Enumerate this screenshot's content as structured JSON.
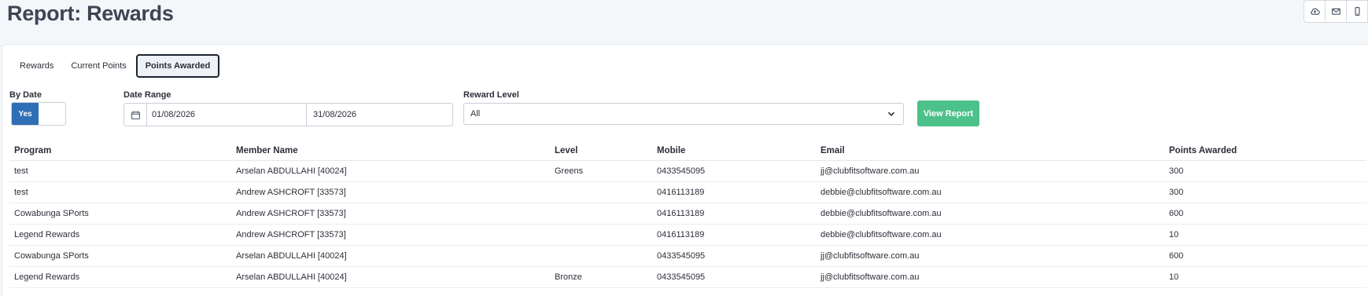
{
  "page_title": "Report: Rewards",
  "top_actions": [
    {
      "icon": "cloud-upload-icon"
    },
    {
      "icon": "envelope-icon"
    },
    {
      "icon": "mobile-icon"
    }
  ],
  "tabs": [
    {
      "label": "Rewards"
    },
    {
      "label": "Current Points"
    },
    {
      "label": "Points Awarded",
      "active": true
    }
  ],
  "filters": {
    "by_date_label": "By Date",
    "by_date_value": "Yes",
    "date_range_label": "Date Range",
    "date_from": "01/08/2026",
    "date_to": "31/08/2026",
    "reward_level_label": "Reward Level",
    "reward_level_value": "All",
    "view_report_label": "View Report"
  },
  "colors": {
    "accent": "#2f6fb5",
    "success_button": "#4cc18a",
    "title": "#3d4555"
  },
  "table": {
    "headers": [
      "Program",
      "Member Name",
      "Level",
      "Mobile",
      "Email",
      "Points Awarded"
    ],
    "rows": [
      [
        "test",
        "Arselan ABDULLAHI [40024]",
        "Greens",
        "0433545095",
        "jj@clubfitsoftware.com.au",
        "300"
      ],
      [
        "test",
        "Andrew ASHCROFT [33573]",
        "",
        "0416113189",
        "debbie@clubfitsoftware.com.au",
        "300"
      ],
      [
        "Cowabunga SPorts",
        "Andrew ASHCROFT [33573]",
        "",
        "0416113189",
        "debbie@clubfitsoftware.com.au",
        "600"
      ],
      [
        "Legend Rewards",
        "Andrew ASHCROFT [33573]",
        "",
        "0416113189",
        "debbie@clubfitsoftware.com.au",
        "10"
      ],
      [
        "Cowabunga SPorts",
        "Arselan ABDULLAHI [40024]",
        "",
        "0433545095",
        "jj@clubfitsoftware.com.au",
        "600"
      ],
      [
        "Legend Rewards",
        "Arselan ABDULLAHI [40024]",
        "Bronze",
        "0433545095",
        "jj@clubfitsoftware.com.au",
        "10"
      ]
    ]
  }
}
